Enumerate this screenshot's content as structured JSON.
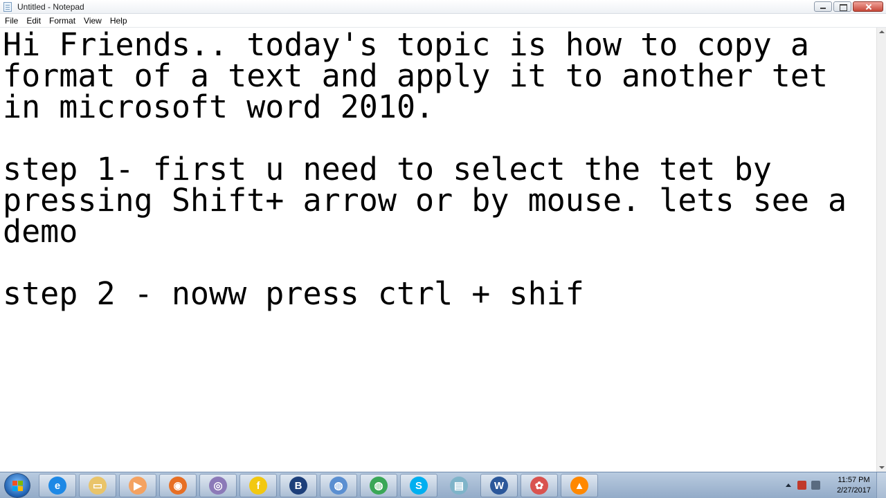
{
  "window": {
    "title": "Untitled - Notepad",
    "controls": [
      "minimize",
      "maximize",
      "close"
    ]
  },
  "menu": {
    "file": "File",
    "edit": "Edit",
    "format": "Format",
    "view": "View",
    "help": "Help"
  },
  "editor": {
    "content": "Hi Friends.. today's topic is how to copy a\nformat of a text and apply it to another tet\nin microsoft word 2010.\n\nstep 1- first u need to select the tet by\npressing Shift+ arrow or by mouse. lets see a\ndemo\n\nstep 2 - noww press ctrl + shif"
  },
  "taskbar": {
    "pinned": [
      {
        "name": "internet-explorer",
        "glyph": "e",
        "color": "#1e88e5"
      },
      {
        "name": "file-explorer",
        "glyph": "▭",
        "color": "#e9c46a"
      },
      {
        "name": "media-player",
        "glyph": "▶",
        "color": "#f4a261"
      },
      {
        "name": "firefox",
        "glyph": "◉",
        "color": "#e76f24"
      },
      {
        "name": "app-swirl",
        "glyph": "◎",
        "color": "#8c7ab8"
      },
      {
        "name": "flipkart",
        "glyph": "f",
        "color": "#f2c811"
      },
      {
        "name": "app-b",
        "glyph": "B",
        "color": "#1d3f7a"
      },
      {
        "name": "chromium",
        "glyph": "◍",
        "color": "#5b8fd1"
      },
      {
        "name": "chrome",
        "glyph": "◍",
        "color": "#3aa757"
      },
      {
        "name": "skype",
        "glyph": "S",
        "color": "#00aff0"
      },
      {
        "name": "notepad",
        "glyph": "▤",
        "color": "#7fb4c9"
      },
      {
        "name": "word",
        "glyph": "W",
        "color": "#2b579a"
      },
      {
        "name": "picasa",
        "glyph": "✿",
        "color": "#d9534f"
      },
      {
        "name": "vlc",
        "glyph": "▲",
        "color": "#ff8800"
      }
    ],
    "clock_time": "11:57 PM",
    "clock_date": "2/27/2017"
  }
}
